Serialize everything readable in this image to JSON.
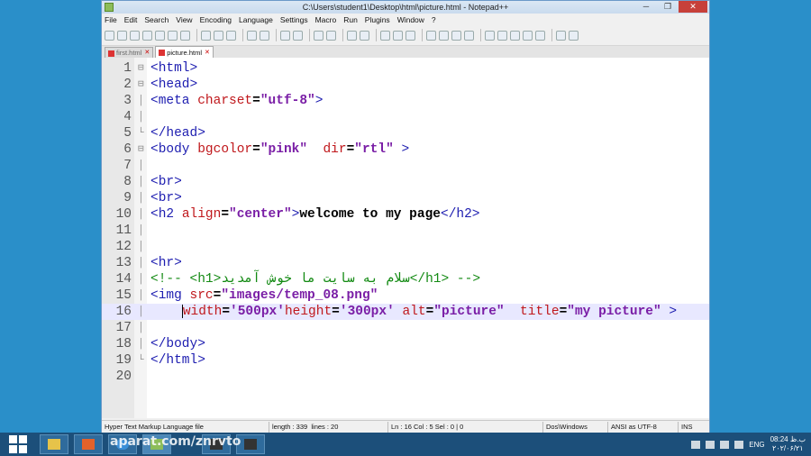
{
  "window": {
    "title": "C:\\Users\\student1\\Desktop\\html\\picture.html - Notepad++",
    "controls": {
      "minimize": "─",
      "maximize": "❐",
      "close": "✕"
    }
  },
  "menu": [
    "File",
    "Edit",
    "Search",
    "View",
    "Encoding",
    "Language",
    "Settings",
    "Macro",
    "Run",
    "Plugins",
    "Window",
    "?"
  ],
  "tabs": [
    {
      "label": "first.html",
      "active": false
    },
    {
      "label": "picture.html",
      "active": true
    }
  ],
  "editor": {
    "current_line": 16,
    "lines": [
      {
        "n": "1",
        "fold": "⊟",
        "segs": [
          [
            "tg",
            "<html>"
          ]
        ]
      },
      {
        "n": "2",
        "fold": "⊟",
        "segs": [
          [
            "tg",
            "<head>"
          ]
        ]
      },
      {
        "n": "3",
        "fold": "│",
        "segs": [
          [
            "tg",
            "<meta "
          ],
          [
            "at",
            "charset"
          ],
          [
            "tx",
            "="
          ],
          [
            "st",
            "\"utf-8\""
          ],
          [
            "tg",
            ">"
          ]
        ]
      },
      {
        "n": "4",
        "fold": "│",
        "segs": []
      },
      {
        "n": "5",
        "fold": "└",
        "segs": [
          [
            "tg",
            "</head>"
          ]
        ]
      },
      {
        "n": "6",
        "fold": "⊟",
        "segs": [
          [
            "tg",
            "<body "
          ],
          [
            "at",
            "bgcolor"
          ],
          [
            "tx",
            "="
          ],
          [
            "st",
            "\"pink\""
          ],
          [
            "tx",
            "  "
          ],
          [
            "at",
            "dir"
          ],
          [
            "tx",
            "="
          ],
          [
            "st",
            "\"rtl\""
          ],
          [
            "tg",
            " >"
          ]
        ]
      },
      {
        "n": "7",
        "fold": "│",
        "segs": []
      },
      {
        "n": "8",
        "fold": "│",
        "segs": [
          [
            "tg",
            "<br>"
          ]
        ]
      },
      {
        "n": "9",
        "fold": "│",
        "segs": [
          [
            "tg",
            "<br>"
          ]
        ]
      },
      {
        "n": "10",
        "fold": "│",
        "segs": [
          [
            "tg",
            "<h2 "
          ],
          [
            "at",
            "align"
          ],
          [
            "tx",
            "="
          ],
          [
            "st",
            "\"center\""
          ],
          [
            "tg",
            ">"
          ],
          [
            "tx",
            "welcome to my page"
          ],
          [
            "tg",
            "</h2>"
          ]
        ]
      },
      {
        "n": "11",
        "fold": "│",
        "segs": []
      },
      {
        "n": "12",
        "fold": "│",
        "segs": []
      },
      {
        "n": "13",
        "fold": "│",
        "segs": [
          [
            "tg",
            "<hr>"
          ]
        ]
      },
      {
        "n": "14",
        "fold": "│",
        "segs": [
          [
            "cm",
            "<!-- <h1>سلام به سایت ما خوش آمدید</h1> -->"
          ]
        ]
      },
      {
        "n": "15",
        "fold": "│",
        "segs": [
          [
            "tg",
            "<img "
          ],
          [
            "at",
            "src"
          ],
          [
            "tx",
            "="
          ],
          [
            "st",
            "\"images/temp_08.png\""
          ]
        ]
      },
      {
        "n": "16",
        "fold": "│",
        "segs": [
          [
            "tx",
            "    "
          ],
          [
            "caret",
            ""
          ],
          [
            "at",
            "width"
          ],
          [
            "tx",
            "="
          ],
          [
            "st",
            "'500px'"
          ],
          [
            "at",
            "height"
          ],
          [
            "tx",
            "="
          ],
          [
            "st",
            "'300px'"
          ],
          [
            "tx",
            " "
          ],
          [
            "at",
            "alt"
          ],
          [
            "tx",
            "="
          ],
          [
            "st",
            "\"picture\""
          ],
          [
            "tx",
            "  "
          ],
          [
            "at",
            "title"
          ],
          [
            "tx",
            "="
          ],
          [
            "st",
            "\"my picture\""
          ],
          [
            "tg",
            " >"
          ]
        ]
      },
      {
        "n": "17",
        "fold": "│",
        "segs": []
      },
      {
        "n": "18",
        "fold": "│",
        "segs": [
          [
            "tg",
            "</body>"
          ]
        ]
      },
      {
        "n": "19",
        "fold": "└",
        "segs": [
          [
            "tg",
            "</html>"
          ]
        ]
      },
      {
        "n": "20",
        "fold": "",
        "segs": []
      }
    ]
  },
  "status": {
    "filetype": "Hyper Text Markup Language file",
    "length": "length : 339",
    "lines": "lines : 20",
    "position": "Ln : 16   Col : 5   Sel : 0 | 0",
    "eol": "Dos\\Windows",
    "encoding": "ANSI as UTF-8",
    "mode": "INS"
  },
  "taskbar": {
    "watermark": "aparat.com/znrvto",
    "language": "ENG",
    "time": "08:24 ب.ظ",
    "date": "۲۰۲/۰۶/۲۱"
  },
  "colors": {
    "tag": "#1d1db0",
    "attribute": "#c0181c",
    "string": "#7a1ea6",
    "comment": "#138a13",
    "current_line": "#e8e8ff"
  }
}
